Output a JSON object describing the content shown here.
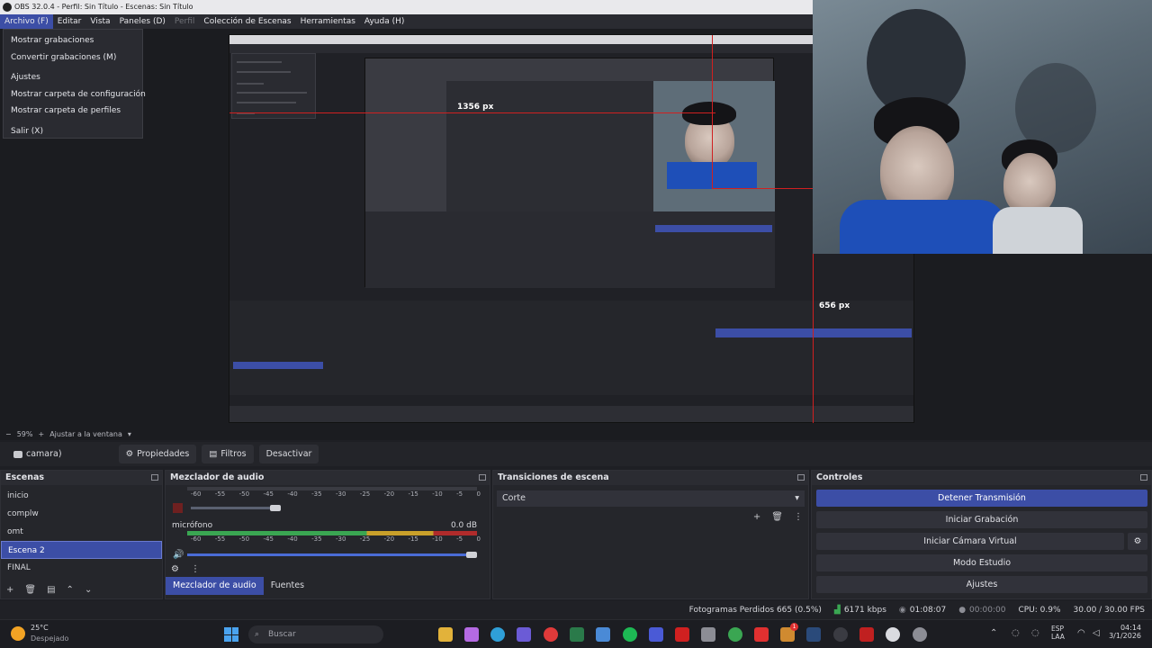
{
  "window": {
    "title": "OBS 32.0.4 - Perfil: Sin Título - Escenas: Sin Título"
  },
  "menubar": [
    {
      "label": "Archivo (F)",
      "active": true
    },
    {
      "label": "Editar"
    },
    {
      "label": "Vista"
    },
    {
      "label": "Paneles (D)"
    },
    {
      "label": "Perfil",
      "disabled": true
    },
    {
      "label": "Colección de Escenas"
    },
    {
      "label": "Herramientas"
    },
    {
      "label": "Ayuda (H)"
    }
  ],
  "file_menu": [
    "Mostrar grabaciones",
    "Convertir grabaciones (M)",
    "Ajustes",
    "Mostrar carpeta de configuración",
    "Mostrar carpeta de perfiles",
    "Salir (X)"
  ],
  "preview": {
    "label_1356": "1356 px",
    "label_656": "656 px"
  },
  "zoom": {
    "value": "59%",
    "fit": "Ajustar a la ventana"
  },
  "source_toolbar": {
    "source": "camara)",
    "properties": "Propiedades",
    "filters": "Filtros",
    "deactivate": "Desactivar"
  },
  "scenes": {
    "title": "Escenas",
    "items": [
      "inicio",
      "complw",
      "omt",
      "Escena 2",
      "FINAL"
    ],
    "selected": "Escena 2"
  },
  "mixer": {
    "title": "Mezclador de audio",
    "ticks": [
      "-60",
      "-55",
      "-50",
      "-45",
      "-40",
      "-35",
      "-30",
      "-25",
      "-20",
      "-15",
      "-10",
      "-5",
      "0"
    ],
    "channel": {
      "name": "micrófono",
      "db": "0.0 dB"
    },
    "tabs": [
      "Mezclador de audio",
      "Fuentes"
    ]
  },
  "transitions": {
    "title": "Transiciones de escena",
    "selected": "Corte"
  },
  "controls": {
    "title": "Controles",
    "buttons": [
      "Detener Transmisión",
      "Iniciar Grabación",
      "Iniciar Cámara Virtual",
      "Modo Estudio",
      "Ajustes"
    ]
  },
  "status": {
    "dropped": "Fotogramas Perdidos 665 (0.5%)",
    "bitrate": "6171 kbps",
    "stream_time": "01:08:07",
    "rec_time": "00:00:00",
    "cpu": "CPU: 0.9%",
    "fps": "30.00 / 30.00 FPS"
  },
  "taskbar": {
    "weather_temp": "25°C",
    "weather_desc": "Despejado",
    "search_placeholder": "Buscar",
    "lang_1": "ESP",
    "lang_2": "LAA",
    "time": "04:14",
    "date": "3/1/2026",
    "badge": "1"
  },
  "colors": {
    "accent": "#3c4ea6",
    "background": "#1e1f24",
    "red_guide": "#d02020"
  }
}
